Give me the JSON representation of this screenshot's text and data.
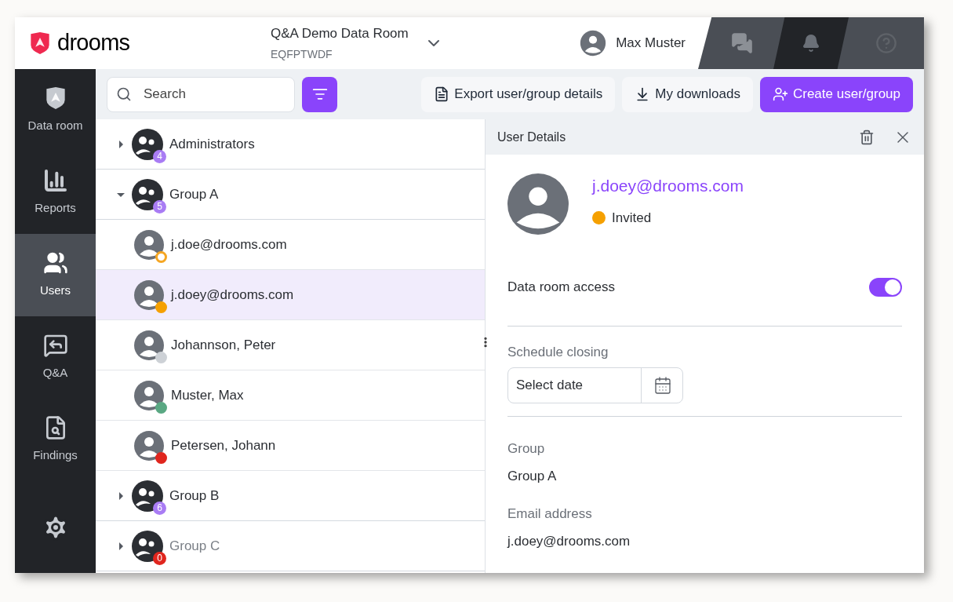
{
  "header": {
    "logo": "drooms",
    "room_title": "Q&A Demo Data Room",
    "room_code": "EQFPTWDF",
    "user_name": "Max Muster"
  },
  "sidebar": {
    "items": [
      {
        "kind": "dataroom",
        "label": "Data room",
        "selected": false
      },
      {
        "kind": "reports",
        "label": "Reports",
        "selected": false
      },
      {
        "kind": "users",
        "label": "Users",
        "selected": true
      },
      {
        "kind": "qa",
        "label": "Q&A",
        "selected": false
      },
      {
        "kind": "findings",
        "label": "Findings",
        "selected": false
      }
    ]
  },
  "toolbar": {
    "search": {
      "placeholder": "Search"
    },
    "buttons": [
      {
        "kind": "export",
        "label": "Export user/group details"
      },
      {
        "kind": "downloads",
        "label": "My downloads"
      },
      {
        "kind": "create",
        "label": "Create user/group"
      }
    ]
  },
  "tree": [
    {
      "name": "Administrators",
      "count": "4",
      "color": "#a97cf4",
      "expanded": false,
      "disabled": false
    },
    {
      "name": "Group A",
      "count": "5",
      "color": "#a97cf4",
      "expanded": true,
      "disabled": false,
      "children": [
        {
          "name": "j.doe@drooms.com",
          "color": "#f5a623",
          "hollow": true,
          "selected": false
        },
        {
          "name": "j.doey@drooms.com",
          "color": "#f5a000",
          "hollow": false,
          "selected": true
        },
        {
          "name": "Johannson, Peter",
          "color": "#cdd1d6",
          "hollow": false,
          "selected": false
        },
        {
          "name": "Muster, Max",
          "color": "#5aa883",
          "hollow": false,
          "selected": false
        },
        {
          "name": "Petersen, Johann",
          "color": "#e0261e",
          "hollow": false,
          "selected": false
        }
      ]
    },
    {
      "name": "Group B",
      "count": "6",
      "color": "#a97cf4",
      "expanded": false,
      "disabled": false
    },
    {
      "name": "Group C",
      "count": "0",
      "color": "#e0261e",
      "expanded": false,
      "disabled": true
    }
  ],
  "details": {
    "title": "User Details",
    "email": "j.doey@drooms.com",
    "status": {
      "text": "Invited",
      "color": "#f5a000"
    },
    "access_label": "Data room access",
    "access_on": true,
    "schedule_label": "Schedule closing",
    "date_placeholder": "Select date",
    "group_label": "Group",
    "group_value": "Group A",
    "email_label": "Email address",
    "email_value": "j.doey@drooms.com"
  }
}
